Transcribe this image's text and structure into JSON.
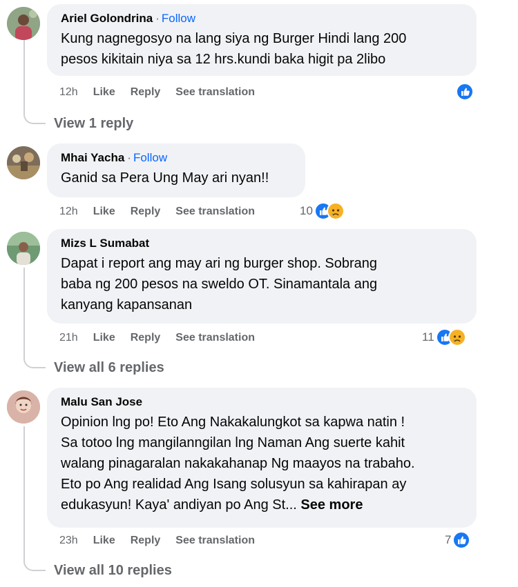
{
  "comments": [
    {
      "name": "Ariel Golondrina",
      "follow": "Follow",
      "text_lines": [
        "Kung nagnegosyo na lang siya ng Burger Hindi lang 200",
        "pesos kikitain niya sa 12 hrs.kundi baka higit pa 2libo"
      ],
      "time": "12h",
      "like": "Like",
      "reply": "Reply",
      "translate": "See translation",
      "reaction_count": "",
      "reactions": [
        "like"
      ],
      "view_replies": "View 1 reply"
    },
    {
      "name": "Mhai Yacha",
      "follow": "Follow",
      "text_lines": [
        "Ganid sa Pera Ung May ari nyan!!"
      ],
      "time": "12h",
      "like": "Like",
      "reply": "Reply",
      "translate": "See translation",
      "reaction_count": "10",
      "reactions": [
        "like",
        "sad"
      ],
      "view_replies": ""
    },
    {
      "name": "Mizs L Sumabat",
      "follow": "",
      "text_lines": [
        "Dapat i report ang may ari ng burger shop. Sobrang",
        "baba ng 200 pesos na sweldo OT. Sinamantala ang",
        "kanyang kapansanan"
      ],
      "time": "21h",
      "like": "Like",
      "reply": "Reply",
      "translate": "See translation",
      "reaction_count": "11",
      "reactions": [
        "like",
        "sad"
      ],
      "view_replies": "View all 6 replies"
    },
    {
      "name": "Malu San Jose",
      "follow": "",
      "text_lines": [
        "Opinion lng po! Eto Ang Nakakalungkot sa kapwa natin !",
        "Sa totoo lng mangilanngilan lng Naman Ang suerte kahit",
        "walang pinagaralan nakakahanap Ng maayos na trabaho.",
        "Eto po Ang realidad Ang Isang solusyun sa kahirapan ay",
        "edukasyun! Kaya' andiyan po Ang St..."
      ],
      "see_more": "See more",
      "time": "23h",
      "like": "Like",
      "reply": "Reply",
      "translate": "See translation",
      "reaction_count": "7",
      "reactions": [
        "like"
      ],
      "view_replies": "View all 10 replies"
    }
  ],
  "colors": {
    "bubble": "#f0f2f5",
    "meta": "#65676b",
    "follow": "#0866ff",
    "like_blue": "#1877f2",
    "sad_yellow": "#f7b125"
  },
  "icons": {
    "like": "thumbs-up-reaction-icon",
    "sad": "sad-face-reaction-icon"
  }
}
